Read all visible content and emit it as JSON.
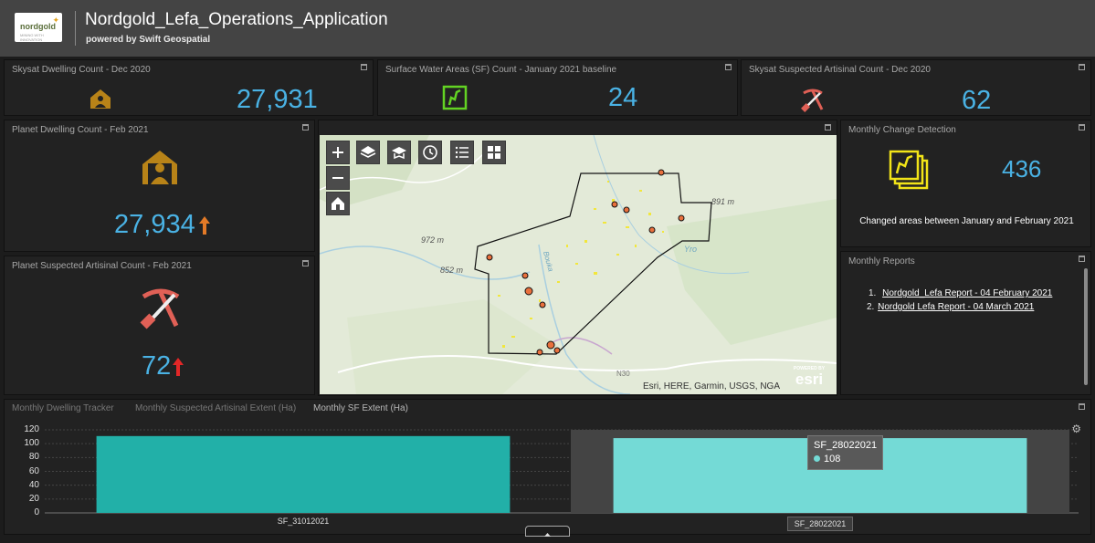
{
  "header": {
    "logo_text": "nordgold",
    "logo_sub": "MINING WITH INNOVATION",
    "title": "Nordgold_Lefa_Operations_Application",
    "subtitle": "powered by Swift Geospatial"
  },
  "indicators": {
    "skysat_dwelling": {
      "title": "Skysat Dwelling Count - Dec 2020",
      "value": "27,931",
      "icon": "house-icon",
      "color": "#b88318"
    },
    "surface_water": {
      "title": "Surface Water Areas (SF) Count - January 2021 baseline",
      "value": "24",
      "icon": "water-area-icon",
      "color": "#63d323"
    },
    "skysat_artisinal": {
      "title": "Skysat Suspected Artisinal Count - Dec 2020",
      "value": "62",
      "icon": "pickaxe-shovel-icon",
      "color": "#e06056"
    },
    "planet_dwelling": {
      "title": "Planet Dwelling Count - Feb 2021",
      "value": "27,934",
      "trend": "up",
      "trend_color": "#e37a27",
      "icon": "house-icon"
    },
    "planet_artisinal": {
      "title": "Planet Suspected Artisinal Count - Feb 2021",
      "value": "72",
      "trend": "up",
      "trend_color": "#e32727",
      "icon": "pickaxe-shovel-icon"
    },
    "change_detection": {
      "title": "Monthly Change Detection",
      "value": "436",
      "caption": "Changed areas between January and February 2021",
      "icon": "layered-map-icon",
      "color": "#f2e418"
    }
  },
  "map": {
    "tools": [
      "zoom-in",
      "zoom-out",
      "home",
      "layers",
      "basemap",
      "time",
      "legend",
      "grid"
    ],
    "labels": {
      "elev_972": "972 m",
      "elev_852": "852 m",
      "elev_891": "891 m",
      "river": "Bouka",
      "place": "Yro",
      "road": "N30"
    },
    "attribution": "Esri, HERE, Garmin, USGS, NGA",
    "esri_badge_top": "POWERED BY",
    "esri_badge": "esri"
  },
  "reports": {
    "title": "Monthly Reports",
    "items": [
      {
        "num": "1.",
        "label": "Nordgold_Lefa Report - 04 February 2021"
      },
      {
        "num": "2.",
        "label": "Nordgold Lefa Report - 04 March 2021"
      }
    ]
  },
  "chart_panel": {
    "tabs": [
      "Monthly Dwelling Tracker",
      "Monthly Suspected Artisinal Extent (Ha)",
      "Monthly SF Extent (Ha)"
    ],
    "active_tab": 2,
    "tooltip": {
      "label": "SF_28022021",
      "value": "108"
    }
  },
  "chart_data": {
    "type": "bar",
    "categories": [
      "SF_31012021",
      "SF_28022021"
    ],
    "values": [
      111,
      108
    ],
    "colors": [
      "#22b0a8",
      "#74dad6"
    ],
    "ylim": [
      0,
      120
    ],
    "yticks": [
      0,
      20,
      40,
      60,
      80,
      100,
      120
    ],
    "highlighted": "SF_28022021",
    "grid": true,
    "title": "",
    "xlabel": "",
    "ylabel": ""
  }
}
